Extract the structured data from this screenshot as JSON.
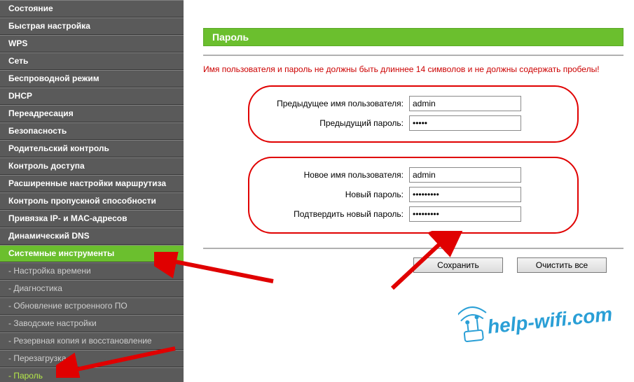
{
  "sidebar": {
    "items": [
      {
        "label": "Состояние",
        "kind": "top"
      },
      {
        "label": "Быстрая настройка",
        "kind": "top"
      },
      {
        "label": "WPS",
        "kind": "top"
      },
      {
        "label": "Сеть",
        "kind": "top"
      },
      {
        "label": "Беспроводной режим",
        "kind": "top"
      },
      {
        "label": "DHCP",
        "kind": "top"
      },
      {
        "label": "Переадресация",
        "kind": "top"
      },
      {
        "label": "Безопасность",
        "kind": "top"
      },
      {
        "label": "Родительский контроль",
        "kind": "top"
      },
      {
        "label": "Контроль доступа",
        "kind": "top"
      },
      {
        "label": "Расширенные настройки маршрутиза",
        "kind": "top"
      },
      {
        "label": "Контроль пропускной способности",
        "kind": "top"
      },
      {
        "label": "Привязка IP- и МАС-адресов",
        "kind": "top"
      },
      {
        "label": "Динамический DNS",
        "kind": "top"
      },
      {
        "label": "Системные инструменты",
        "kind": "active"
      },
      {
        "label": "- Настройка времени",
        "kind": "sub"
      },
      {
        "label": "- Диагностика",
        "kind": "sub"
      },
      {
        "label": "- Обновление встроенного ПО",
        "kind": "sub"
      },
      {
        "label": "- Заводские настройки",
        "kind": "sub"
      },
      {
        "label": "- Резервная копия и восстановление",
        "kind": "sub"
      },
      {
        "label": "- Перезагрузка",
        "kind": "sub"
      },
      {
        "label": "- Пароль",
        "kind": "sub sel"
      }
    ]
  },
  "panel": {
    "title": "Пароль",
    "warning": "Имя пользователя и пароль не должны быть длиннее 14 символов и не должны содержать пробелы!",
    "prev_user_label": "Предыдущее имя пользователя:",
    "prev_user_value": "admin",
    "prev_pass_label": "Предыдущий пароль:",
    "prev_pass_value": "•••••",
    "new_user_label": "Новое имя пользователя:",
    "new_user_value": "admin",
    "new_pass_label": "Новый пароль:",
    "new_pass_value": "•••••••••",
    "confirm_pass_label": "Подтвердить новый пароль:",
    "confirm_pass_value": "•••••••••",
    "save": "Сохранить",
    "clear": "Очистить все"
  },
  "watermark": "help-wifi.com"
}
